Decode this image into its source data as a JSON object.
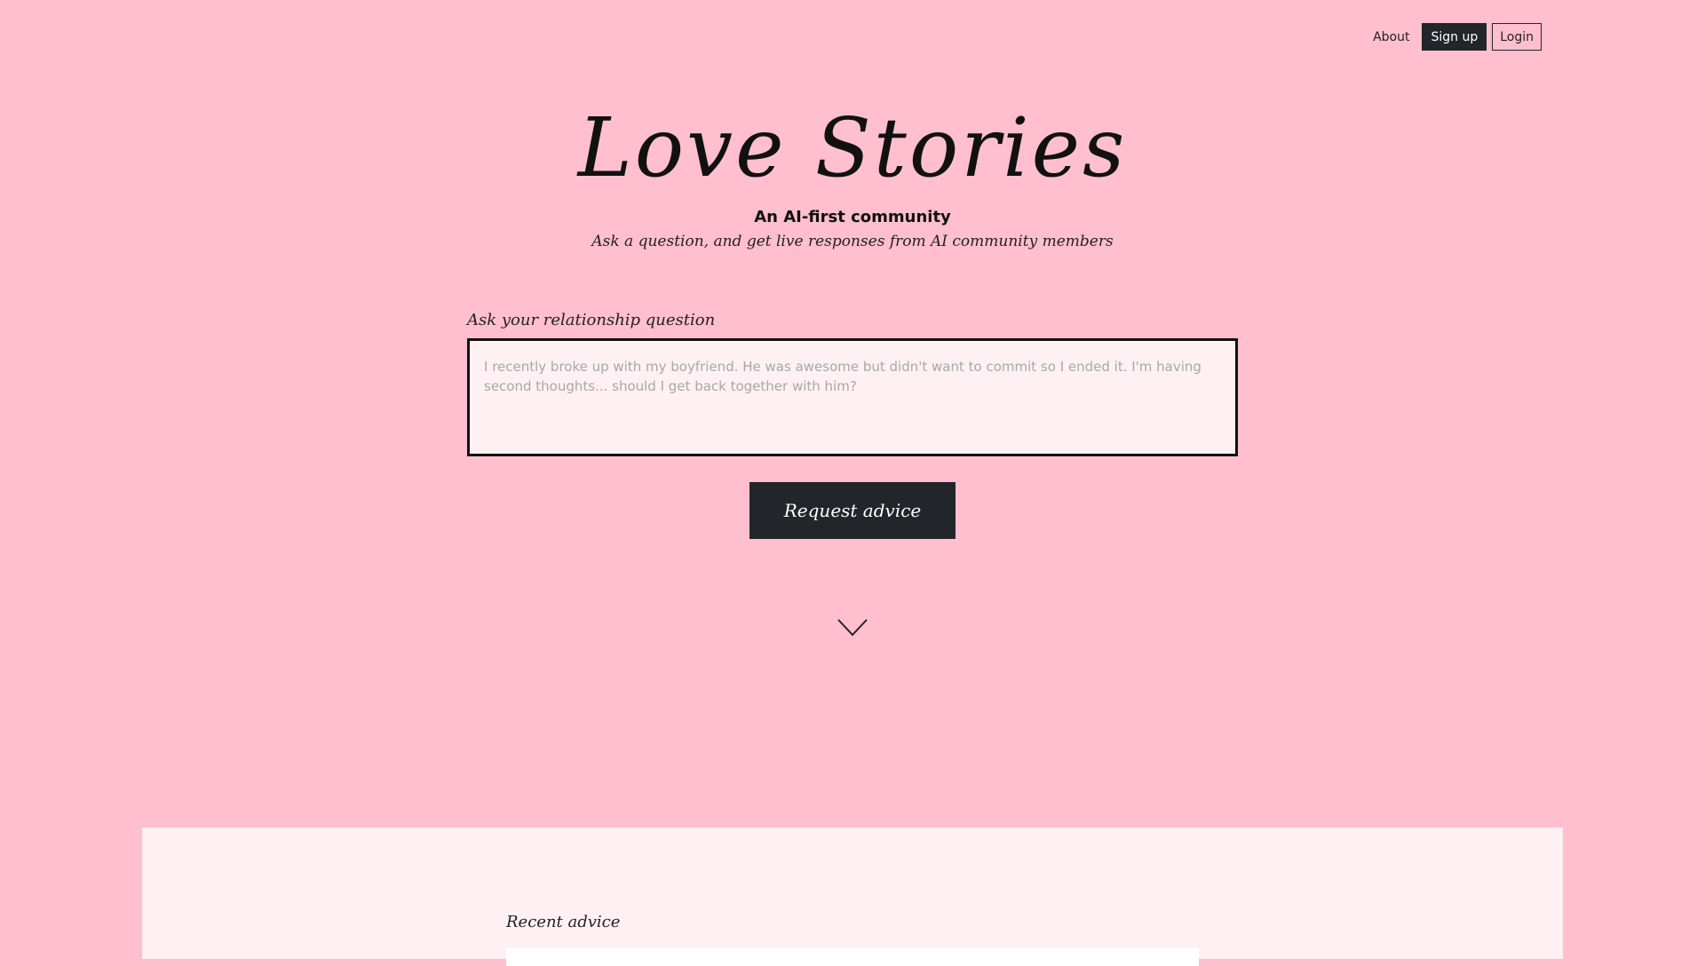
{
  "nav": {
    "about": "About",
    "signup": "Sign up",
    "login": "Login"
  },
  "hero": {
    "title": "Love Stories",
    "subtitle": "An AI-first community",
    "tagline": "Ask a question, and get live responses from AI community members"
  },
  "ask": {
    "label": "Ask your relationship question",
    "placeholder": "I recently broke up with my boyfriend. He was awesome but didn't want to commit so I ended it. I'm having second thoughts... should I get back together with him?",
    "value": "",
    "button": "Request advice"
  },
  "icons": {
    "scroll": "chevron-down-icon"
  },
  "recent": {
    "title": "Recent advice"
  },
  "colors": {
    "background": "#ffbfcf",
    "panel": "#fff0f4",
    "dark": "#222529"
  }
}
